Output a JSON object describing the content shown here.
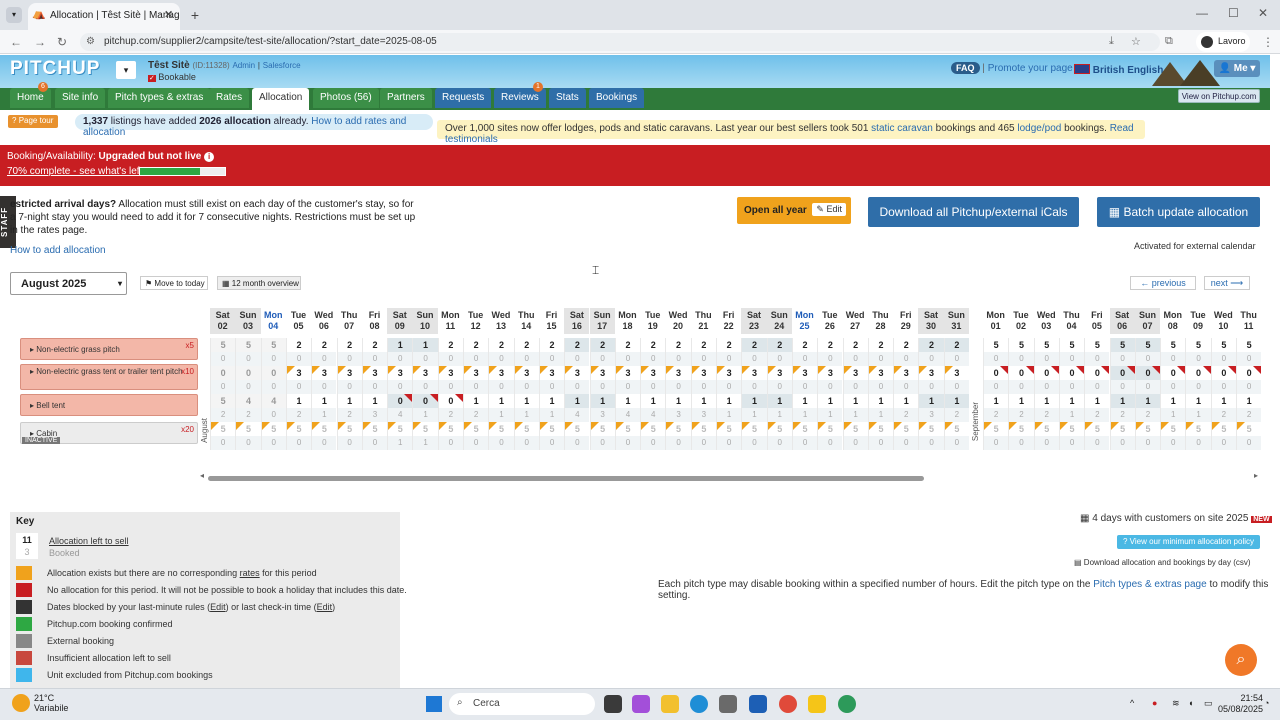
{
  "browser": {
    "tab_title": "Allocation | Têst Sitè | Manage",
    "url": "pitchup.com/supplier2/campsite/test-site/allocation/?start_date=2025-08-05",
    "profile": "Lavoro"
  },
  "header": {
    "logo": "PITCHUP",
    "site_name": "Têst Sitè",
    "site_id": "(ID:11328)",
    "admin": "Admin",
    "salesforce": "Salesforce",
    "bookable": "Bookable",
    "faq": "FAQ",
    "promote": "Promote your page",
    "language": "British English",
    "me": "Me",
    "view_on": "View on Pitchup.com"
  },
  "nav": {
    "tabs": [
      {
        "label": "Home",
        "badge": "6"
      },
      {
        "label": "Site info"
      },
      {
        "label": "Pitch types & extras"
      },
      {
        "label": "Rates"
      },
      {
        "label": "Allocation"
      },
      {
        "label": "Photos (56)"
      },
      {
        "label": "Partners"
      },
      {
        "label": "Requests"
      },
      {
        "label": "Reviews",
        "badge": "1"
      },
      {
        "label": "Stats"
      },
      {
        "label": "Bookings"
      }
    ]
  },
  "info": {
    "page_tour": "Page tour",
    "listings_count": "1,337",
    "listings_text": " listings have added ",
    "alloc_count": "2026 allocation",
    "already": " already. ",
    "howto_rates": "How to add rates and allocation",
    "lodges_a": "Over 1,000 sites now offer lodges, pods and static caravans. Last year our best sellers took 501 ",
    "static_caravan": "static caravan",
    "lodges_b": " bookings and 465 ",
    "lodge_pod": "lodge/pod",
    "lodges_c": " bookings. ",
    "read_testimonials": "Read testimonials"
  },
  "banner": {
    "label": "Booking/Availability: ",
    "status": "Upgraded but not live",
    "complete": "70% complete - see what's left",
    "progress": 0.7
  },
  "staff": "STAFF",
  "restricted": {
    "title": "estricted arrival days?",
    "text": " Allocation must still exist on each day of the customer's stay, so for a 7-night stay you would need to add it for 7 consecutive nights. Restrictions must be set up in the rates page.",
    "howto": "How to add allocation"
  },
  "actions": {
    "open_all_year": "Open all year",
    "edit": "Edit",
    "download_icals": "Download all Pitchup/external iCals",
    "batch_update": "Batch update allocation",
    "activated": "Activated for external calendar"
  },
  "controls": {
    "month": "August 2025",
    "move_today": "Move to today",
    "overview": "12 month overview",
    "previous": "← previous",
    "next": "next ⟶"
  },
  "pitch_types": [
    {
      "name": "Non-electric grass pitch",
      "count": "x5"
    },
    {
      "name": "Non-electric grass tent or trailer tent pitch",
      "count": "x10"
    },
    {
      "name": "Bell tent",
      "count": ""
    },
    {
      "name": "Cabin",
      "count": "x20",
      "status": "INACTIVE"
    }
  ],
  "months": {
    "august": "August",
    "september": "September"
  },
  "calendar": {
    "days": [
      {
        "dow": "Sat",
        "d": "02",
        "wk": true,
        "past": true
      },
      {
        "dow": "Sun",
        "d": "03",
        "wk": true,
        "past": true
      },
      {
        "dow": "Mon",
        "d": "04",
        "mon": true,
        "past": true
      },
      {
        "dow": "Tue",
        "d": "05"
      },
      {
        "dow": "Wed",
        "d": "06"
      },
      {
        "dow": "Thu",
        "d": "07"
      },
      {
        "dow": "Fri",
        "d": "08"
      },
      {
        "dow": "Sat",
        "d": "09",
        "wk": true
      },
      {
        "dow": "Sun",
        "d": "10",
        "wk": true
      },
      {
        "dow": "Mon",
        "d": "11"
      },
      {
        "dow": "Tue",
        "d": "12"
      },
      {
        "dow": "Wed",
        "d": "13"
      },
      {
        "dow": "Thu",
        "d": "14"
      },
      {
        "dow": "Fri",
        "d": "15"
      },
      {
        "dow": "Sat",
        "d": "16",
        "wk": true
      },
      {
        "dow": "Sun",
        "d": "17",
        "wk": true
      },
      {
        "dow": "Mon",
        "d": "18"
      },
      {
        "dow": "Tue",
        "d": "19"
      },
      {
        "dow": "Wed",
        "d": "20"
      },
      {
        "dow": "Thu",
        "d": "21"
      },
      {
        "dow": "Fri",
        "d": "22"
      },
      {
        "dow": "Sat",
        "d": "23",
        "wk": true
      },
      {
        "dow": "Sun",
        "d": "24",
        "wk": true
      },
      {
        "dow": "Mon",
        "d": "25",
        "mon": true
      },
      {
        "dow": "Tue",
        "d": "26"
      },
      {
        "dow": "Wed",
        "d": "27"
      },
      {
        "dow": "Thu",
        "d": "28"
      },
      {
        "dow": "Fri",
        "d": "29"
      },
      {
        "dow": "Sat",
        "d": "30",
        "wk": true
      },
      {
        "dow": "Sun",
        "d": "31",
        "wk": true
      }
    ],
    "sep_days": [
      {
        "dow": "Mon",
        "d": "01"
      },
      {
        "dow": "Tue",
        "d": "02"
      },
      {
        "dow": "Wed",
        "d": "03"
      },
      {
        "dow": "Thu",
        "d": "04"
      },
      {
        "dow": "Fri",
        "d": "05"
      },
      {
        "dow": "Sat",
        "d": "06",
        "wk": true
      },
      {
        "dow": "Sun",
        "d": "07",
        "wk": true
      },
      {
        "dow": "Mon",
        "d": "08"
      },
      {
        "dow": "Tue",
        "d": "09"
      },
      {
        "dow": "Wed",
        "d": "10"
      },
      {
        "dow": "Thu",
        "d": "11"
      }
    ],
    "aug_rows": [
      {
        "top": [
          "5",
          "5",
          "5",
          "2",
          "2",
          "2",
          "2",
          "1",
          "1",
          "2",
          "2",
          "2",
          "2",
          "2",
          "2",
          "2",
          "2",
          "2",
          "2",
          "2",
          "2",
          "2",
          "2",
          "2",
          "2",
          "2",
          "2",
          "2",
          "2",
          "2"
        ],
        "sub": [
          "0",
          "0",
          "0",
          "0",
          "0",
          "0",
          "0",
          "0",
          "0",
          "0",
          "0",
          "0",
          "0",
          "0",
          "0",
          "0",
          "0",
          "0",
          "0",
          "0",
          "0",
          "0",
          "0",
          "0",
          "0",
          "0",
          "0",
          "0",
          "0",
          "0"
        ]
      },
      {
        "top": [
          "0",
          "0",
          "0",
          "3",
          "3",
          "3",
          "3",
          "3",
          "3",
          "3",
          "3",
          "3",
          "3",
          "3",
          "3",
          "3",
          "3",
          "3",
          "3",
          "3",
          "3",
          "3",
          "3",
          "3",
          "3",
          "3",
          "3",
          "3",
          "3",
          "3"
        ],
        "sub": [
          "0",
          "0",
          "0",
          "0",
          "0",
          "0",
          "0",
          "0",
          "0",
          "0",
          "0",
          "0",
          "0",
          "0",
          "0",
          "0",
          "0",
          "0",
          "0",
          "0",
          "0",
          "0",
          "0",
          "0",
          "0",
          "0",
          "0",
          "0",
          "0",
          "0"
        ]
      },
      {
        "top": [
          "5",
          "4",
          "4",
          "1",
          "1",
          "1",
          "1",
          "0",
          "0",
          "0",
          "1",
          "1",
          "1",
          "1",
          "1",
          "1",
          "1",
          "1",
          "1",
          "1",
          "1",
          "1",
          "1",
          "1",
          "1",
          "1",
          "1",
          "1",
          "1",
          "1"
        ],
        "sub": [
          "2",
          "2",
          "0",
          "2",
          "1",
          "2",
          "3",
          "4",
          "1",
          "2",
          "2",
          "1",
          "1",
          "1",
          "4",
          "3",
          "4",
          "4",
          "3",
          "3",
          "1",
          "1",
          "1",
          "1",
          "1",
          "1",
          "1",
          "2",
          "3",
          "2"
        ]
      },
      {
        "top": [
          "5",
          "5",
          "5",
          "5",
          "5",
          "5",
          "5",
          "5",
          "5",
          "5",
          "5",
          "5",
          "5",
          "5",
          "5",
          "5",
          "5",
          "5",
          "5",
          "5",
          "5",
          "5",
          "5",
          "5",
          "5",
          "5",
          "5",
          "5",
          "5",
          "5"
        ],
        "sub": [
          "0",
          "0",
          "0",
          "0",
          "0",
          "0",
          "0",
          "1",
          "1",
          "0",
          "0",
          "0",
          "0",
          "0",
          "0",
          "0",
          "0",
          "0",
          "0",
          "0",
          "0",
          "0",
          "0",
          "0",
          "0",
          "0",
          "0",
          "0",
          "0",
          "0"
        ]
      }
    ],
    "sep_rows": [
      {
        "top": [
          "5",
          "5",
          "5",
          "5",
          "5",
          "5",
          "5",
          "5",
          "5",
          "5",
          "5"
        ],
        "sub": [
          "0",
          "0",
          "0",
          "0",
          "0",
          "0",
          "0",
          "0",
          "0",
          "0",
          "0"
        ]
      },
      {
        "top": [
          "0",
          "0",
          "0",
          "0",
          "0",
          "0",
          "0",
          "0",
          "0",
          "0",
          "0"
        ],
        "sub": [
          "0",
          "0",
          "0",
          "0",
          "0",
          "0",
          "0",
          "0",
          "0",
          "0",
          "0"
        ]
      },
      {
        "top": [
          "1",
          "1",
          "1",
          "1",
          "1",
          "1",
          "1",
          "1",
          "1",
          "1",
          "1"
        ],
        "sub": [
          "2",
          "2",
          "2",
          "1",
          "2",
          "2",
          "2",
          "1",
          "1",
          "2",
          "2"
        ]
      },
      {
        "top": [
          "5",
          "5",
          "5",
          "5",
          "5",
          "5",
          "5",
          "5",
          "5",
          "5",
          "5"
        ],
        "sub": [
          "0",
          "0",
          "0",
          "0",
          "0",
          "0",
          "0",
          "0",
          "0",
          "0",
          "0"
        ]
      }
    ]
  },
  "key": {
    "title": "Key",
    "sample_top": "11",
    "sample_sub": "3",
    "alloc_left": "Allocation left to sell",
    "booked": "Booked",
    "items": [
      {
        "text_a": "Allocation exists but there are no corresponding ",
        "link": "rates",
        "text_b": " for this period",
        "color": "#f0a21c"
      },
      {
        "text_a": "No allocation for this period. It will not be possible to book a holiday that includes this date.",
        "color": "#c81e22"
      },
      {
        "text_a": "Dates blocked by your last-minute rules (",
        "link": "Edit",
        "text_b": ") or last check-in time (",
        "link2": "Edit",
        "text_c": ")",
        "color": "#333333"
      },
      {
        "text_a": "Pitchup.com booking confirmed",
        "color": "#2ea843"
      },
      {
        "text_a": "External booking",
        "color": "#888888"
      },
      {
        "text_a": "Insufficient allocation left to sell",
        "color": "#c8483e"
      },
      {
        "text_a": "Unit excluded from Pitchup.com bookings",
        "color": "#3fb6ec"
      }
    ]
  },
  "right": {
    "four_days": "4 days with customers on site 2025",
    "new": "NEW",
    "min_policy": "View our minimum allocation policy",
    "download_csv": "Download allocation and bookings by day (csv)",
    "note_a": "Each pitch type may disable booking within a specified number of hours. Edit the pitch type on the ",
    "note_link": "Pitch types & extras page",
    "note_b": " to modify this setting."
  },
  "taskbar": {
    "temp": "21°C",
    "weather": "Variabile",
    "search": "Cerca",
    "time": "21:54",
    "date": "05/08/2025"
  }
}
